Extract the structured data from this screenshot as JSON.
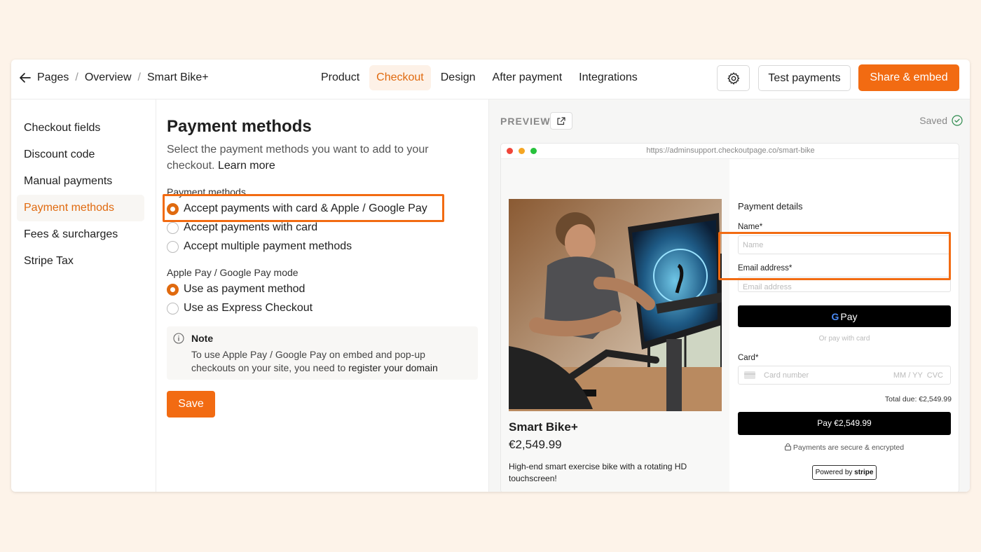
{
  "breadcrumb": [
    "Pages",
    "Overview",
    "Smart Bike+"
  ],
  "tabs": [
    {
      "label": "Product",
      "active": false
    },
    {
      "label": "Checkout",
      "active": true
    },
    {
      "label": "Design",
      "active": false
    },
    {
      "label": "After payment",
      "active": false
    },
    {
      "label": "Integrations",
      "active": false
    }
  ],
  "toolbar": {
    "test_label": "Test payments",
    "share_label": "Share & embed"
  },
  "sidebar": {
    "items": [
      {
        "label": "Checkout fields"
      },
      {
        "label": "Discount code"
      },
      {
        "label": "Manual payments"
      },
      {
        "label": "Payment methods",
        "active": true
      },
      {
        "label": "Fees & surcharges"
      },
      {
        "label": "Stripe Tax"
      }
    ]
  },
  "main": {
    "title": "Payment methods",
    "description": "Select the payment methods you want to add to your checkout.",
    "learn_more": "Learn more",
    "methods_label": "Payment methods",
    "methods": [
      {
        "label": "Accept payments with card & Apple / Google Pay",
        "selected": true
      },
      {
        "label": "Accept payments with card",
        "selected": false
      },
      {
        "label": "Accept multiple payment methods",
        "selected": false
      }
    ],
    "mode_label": "Apple Pay / Google Pay mode",
    "modes": [
      {
        "label": "Use as payment method",
        "selected": true
      },
      {
        "label": "Use as Express Checkout",
        "selected": false
      }
    ],
    "note_title": "Note",
    "note_body": "To use Apple Pay / Google Pay on embed and pop-up checkouts on your site, you need to",
    "note_link": "register your domain",
    "save_label": "Save"
  },
  "preview": {
    "label": "PREVIEW",
    "saved_label": "Saved",
    "url": "https://adminsupport.checkoutpage.co/smart-bike",
    "product_name": "Smart Bike+",
    "product_price": "€2,549.99",
    "product_desc": "High-end smart exercise bike with a rotating HD touchscreen!",
    "payment_details": "Payment details",
    "name_label": "Name",
    "name_placeholder": "Name",
    "email_label": "Email address",
    "email_placeholder": "Email address",
    "gpay_label": "Pay",
    "or_pay": "Or pay with card",
    "card_label": "Card",
    "card_placeholder": "Card number",
    "card_meta": "MM / YY  CVC",
    "total": "Total due: €2,549.99",
    "pay_button": "Pay €2,549.99",
    "secure": "Payments are secure & encrypted",
    "powered_prefix": "Powered by",
    "powered_brand": "stripe"
  },
  "colors": {
    "accent": "#f26b12",
    "background": "#fdf3e9"
  }
}
